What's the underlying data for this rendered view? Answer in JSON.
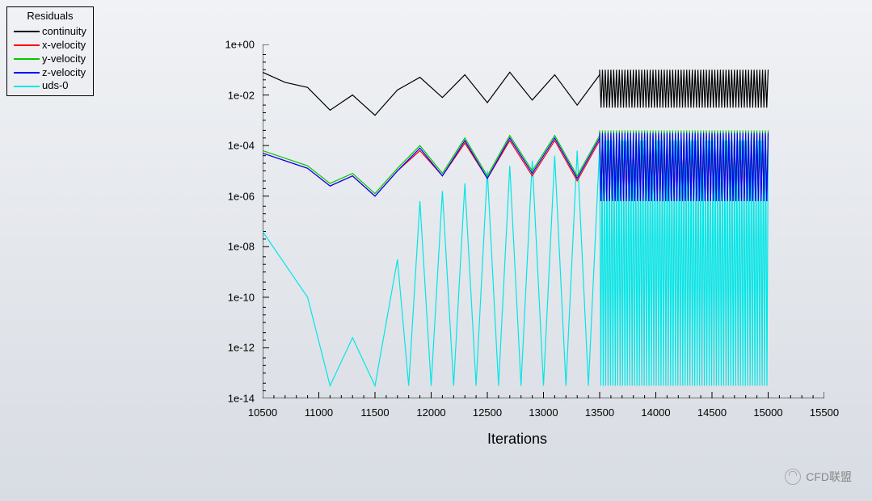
{
  "legend": {
    "title": "Residuals",
    "items": [
      {
        "label": "continuity",
        "color": "#000000"
      },
      {
        "label": "x-velocity",
        "color": "#ff0000"
      },
      {
        "label": "y-velocity",
        "color": "#00c800"
      },
      {
        "label": "z-velocity",
        "color": "#0000ff"
      },
      {
        "label": "uds-0",
        "color": "#00e6e6"
      }
    ]
  },
  "watermark": "CFD联盟",
  "chart_data": {
    "type": "line",
    "title": "",
    "xlabel": "Iterations",
    "ylabel": "",
    "xlim": [
      10500,
      15500
    ],
    "ylim_log": [
      -14,
      0
    ],
    "y_ticks_log": [
      0,
      -2,
      -4,
      -6,
      -8,
      -10,
      -12,
      -14
    ],
    "y_tick_labels": [
      "1e+00",
      "1e-02",
      "1e-04",
      "1e-06",
      "1e-08",
      "1e-10",
      "1e-12",
      "1e-14"
    ],
    "x_ticks": [
      10500,
      11000,
      11500,
      12000,
      12500,
      13000,
      13500,
      14000,
      14500,
      15000,
      15500
    ],
    "log_scale_y": true,
    "series": [
      {
        "name": "continuity",
        "color": "#000000",
        "x": [
          10500,
          10700,
          10900,
          11100,
          11300,
          11500,
          11700,
          11900,
          12100,
          12300,
          12500,
          12700,
          12900,
          13100,
          13300,
          13500
        ],
        "y_log": [
          -1.1,
          -1.5,
          -1.7,
          -2.6,
          -2.0,
          -2.8,
          -1.8,
          -1.3,
          -2.1,
          -1.2,
          -2.3,
          -1.1,
          -2.2,
          -1.2,
          -2.4,
          -1.2
        ],
        "dense_from_x": 13500,
        "dense_to_x": 15000,
        "dense_min_log": -2.5,
        "dense_max_log": -1.0,
        "dense_freq": 120
      },
      {
        "name": "x-velocity",
        "color": "#ff0000",
        "x": [
          10500,
          10700,
          10900,
          11100,
          11300,
          11500,
          11700,
          11900,
          12100,
          12300,
          12500,
          12700,
          12900,
          13100,
          13300,
          13500
        ],
        "y_log": [
          -4.3,
          -4.6,
          -4.9,
          -5.6,
          -5.2,
          -6.0,
          -5.0,
          -4.2,
          -5.2,
          -3.9,
          -5.3,
          -3.8,
          -5.2,
          -3.8,
          -5.4,
          -3.8
        ],
        "dense_from_x": 13500,
        "dense_to_x": 15000,
        "dense_min_log": -6.2,
        "dense_max_log": -3.6,
        "dense_freq": 120
      },
      {
        "name": "y-velocity",
        "color": "#00c800",
        "x": [
          10500,
          10700,
          10900,
          11100,
          11300,
          11500,
          11700,
          11900,
          12100,
          12300,
          12500,
          12700,
          12900,
          13100,
          13300,
          13500
        ],
        "y_log": [
          -4.2,
          -4.5,
          -4.8,
          -5.5,
          -5.1,
          -5.9,
          -4.9,
          -4.0,
          -5.1,
          -3.7,
          -5.2,
          -3.6,
          -5.0,
          -3.6,
          -5.2,
          -3.6
        ],
        "dense_from_x": 13500,
        "dense_to_x": 15000,
        "dense_min_log": -6.0,
        "dense_max_log": -3.4,
        "dense_freq": 120
      },
      {
        "name": "z-velocity",
        "color": "#0000ff",
        "x": [
          10500,
          10700,
          10900,
          11100,
          11300,
          11500,
          11700,
          11900,
          12100,
          12300,
          12500,
          12700,
          12900,
          13100,
          13300,
          13500
        ],
        "y_log": [
          -4.3,
          -4.6,
          -4.9,
          -5.6,
          -5.2,
          -6.0,
          -5.0,
          -4.1,
          -5.2,
          -3.8,
          -5.3,
          -3.7,
          -5.1,
          -3.7,
          -5.3,
          -3.7
        ],
        "dense_from_x": 13500,
        "dense_to_x": 15000,
        "dense_min_log": -6.2,
        "dense_max_log": -3.5,
        "dense_freq": 120
      },
      {
        "name": "uds-0",
        "color": "#00e6e6",
        "x": [
          10500,
          10700,
          10900,
          11100,
          11300,
          11500,
          11700,
          11800,
          11900,
          12000,
          12100,
          12200,
          12300,
          12400,
          12500,
          12600,
          12700,
          12800,
          12900,
          13000,
          13100,
          13200,
          13300,
          13400,
          13500
        ],
        "y_log": [
          -7.4,
          -8.7,
          -10.0,
          -13.5,
          -11.6,
          -13.5,
          -8.5,
          -13.5,
          -6.2,
          -13.5,
          -5.8,
          -13.5,
          -5.5,
          -13.5,
          -5.0,
          -13.5,
          -4.8,
          -13.5,
          -4.6,
          -13.5,
          -4.4,
          -13.5,
          -4.2,
          -13.5,
          -4.0
        ],
        "dense_from_x": 13500,
        "dense_to_x": 15000,
        "dense_min_log": -13.5,
        "dense_max_log": -3.8,
        "dense_freq": 140
      }
    ]
  }
}
